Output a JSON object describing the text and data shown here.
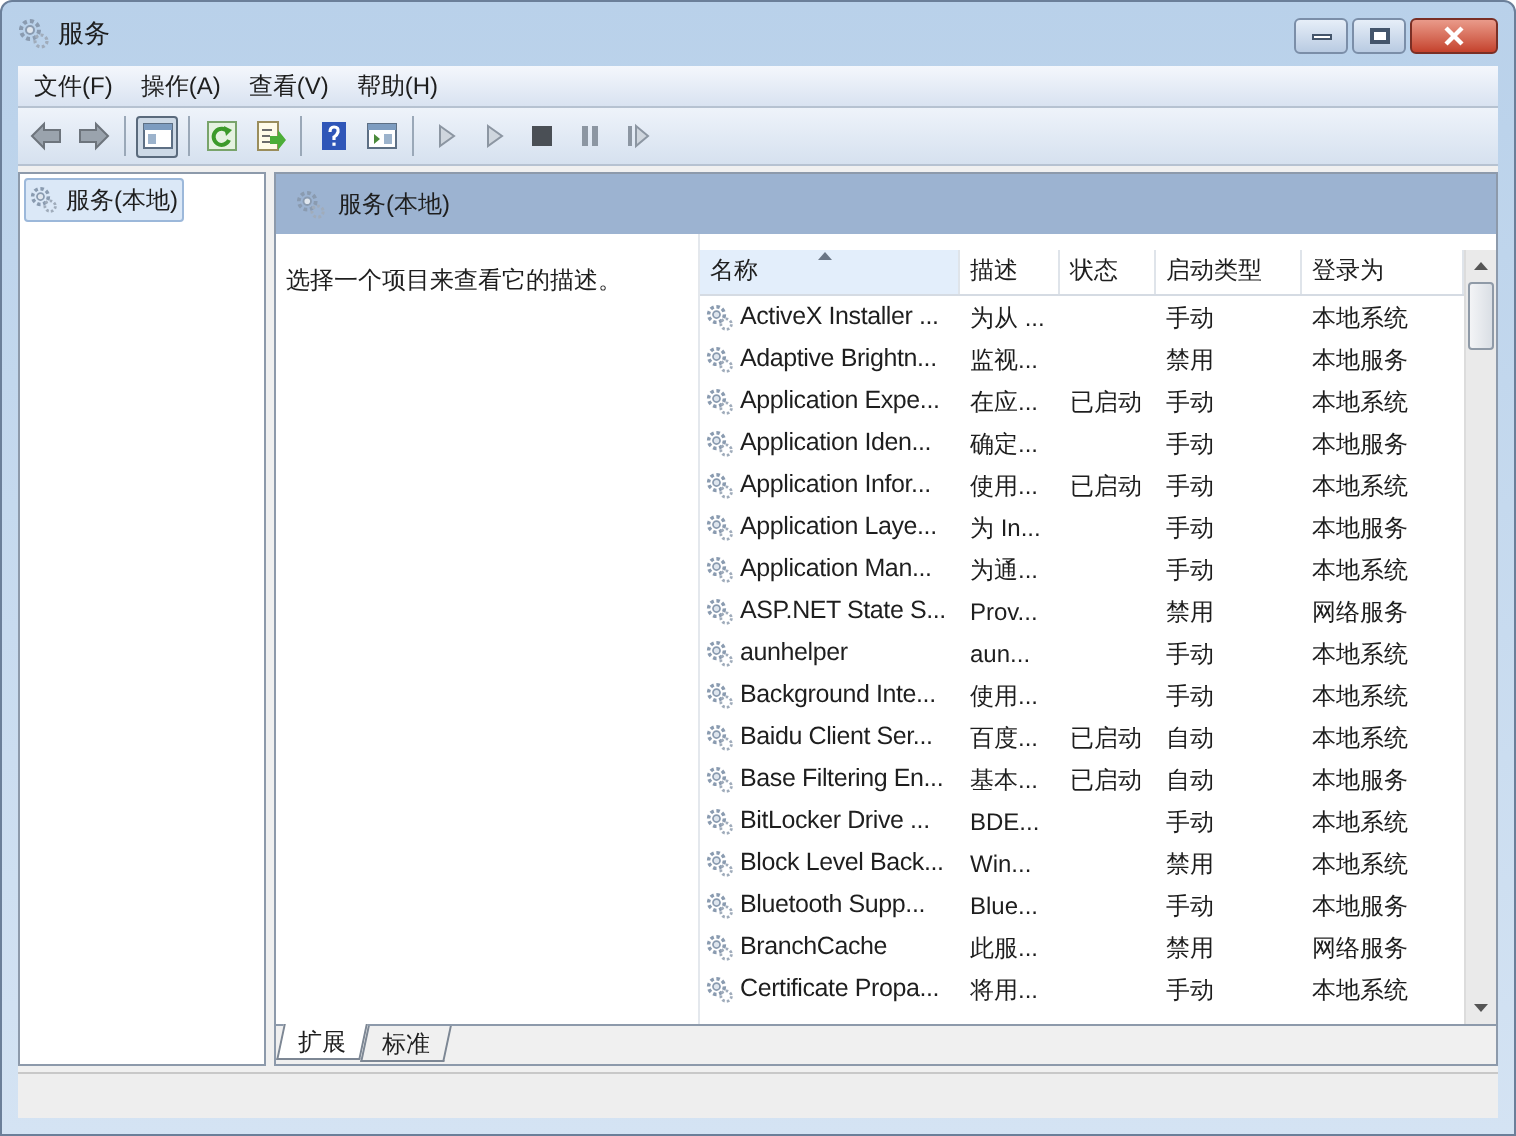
{
  "window": {
    "title": "服务"
  },
  "menu": [
    "文件(F)",
    "操作(A)",
    "查看(V)",
    "帮助(H)"
  ],
  "toolbar": [
    [
      {
        "kind": "back",
        "pressed": false
      },
      {
        "kind": "forward",
        "pressed": false
      }
    ],
    [
      {
        "kind": "tree",
        "pressed": true
      }
    ],
    [
      {
        "kind": "refresh",
        "pressed": false
      },
      {
        "kind": "export",
        "pressed": false
      }
    ],
    [
      {
        "kind": "help",
        "pressed": false
      },
      {
        "kind": "view",
        "pressed": false
      }
    ],
    [
      {
        "kind": "play",
        "pressed": false
      },
      {
        "kind": "play",
        "pressed": false
      },
      {
        "kind": "stop",
        "pressed": false
      },
      {
        "kind": "pause",
        "pressed": false
      },
      {
        "kind": "resume",
        "pressed": false
      }
    ]
  ],
  "tree": {
    "items": [
      {
        "label": "服务(本地)",
        "selected": true
      }
    ]
  },
  "pane": {
    "title": "服务(本地)",
    "description": "选择一个项目来查看它的描述。"
  },
  "table": {
    "columns": [
      {
        "label": "名称",
        "sorted": true
      },
      {
        "label": "描述",
        "sorted": false
      },
      {
        "label": "状态",
        "sorted": false
      },
      {
        "label": "启动类型",
        "sorted": false
      },
      {
        "label": "登录为",
        "sorted": false
      }
    ],
    "rows": [
      [
        "ActiveX Installer ...",
        "为从 ...",
        "",
        "手动",
        "本地系统"
      ],
      [
        "Adaptive Brightn...",
        "监视...",
        "",
        "禁用",
        "本地服务"
      ],
      [
        "Application Expe...",
        "在应...",
        "已启动",
        "手动",
        "本地系统"
      ],
      [
        "Application Iden...",
        "确定...",
        "",
        "手动",
        "本地服务"
      ],
      [
        "Application Infor...",
        "使用...",
        "已启动",
        "手动",
        "本地系统"
      ],
      [
        "Application Laye...",
        "为 In...",
        "",
        "手动",
        "本地服务"
      ],
      [
        "Application Man...",
        "为通...",
        "",
        "手动",
        "本地系统"
      ],
      [
        "ASP.NET State S...",
        "Prov...",
        "",
        "禁用",
        "网络服务"
      ],
      [
        "aunhelper",
        "aun...",
        "",
        "手动",
        "本地系统"
      ],
      [
        "Background Inte...",
        "使用...",
        "",
        "手动",
        "本地系统"
      ],
      [
        "Baidu Client Ser...",
        "百度...",
        "已启动",
        "自动",
        "本地系统"
      ],
      [
        "Base Filtering En...",
        "基本...",
        "已启动",
        "自动",
        "本地服务"
      ],
      [
        "BitLocker Drive ...",
        "BDE...",
        "",
        "手动",
        "本地系统"
      ],
      [
        "Block Level Back...",
        "Win...",
        "",
        "禁用",
        "本地系统"
      ],
      [
        "Bluetooth Supp...",
        "Blue...",
        "",
        "手动",
        "本地服务"
      ],
      [
        "BranchCache",
        "此服...",
        "",
        "禁用",
        "网络服务"
      ],
      [
        "Certificate Propa...",
        "将用...",
        "",
        "手动",
        "本地系统"
      ]
    ]
  },
  "tabs": [
    {
      "label": "扩展",
      "selected": true
    },
    {
      "label": "标准",
      "selected": false
    }
  ]
}
